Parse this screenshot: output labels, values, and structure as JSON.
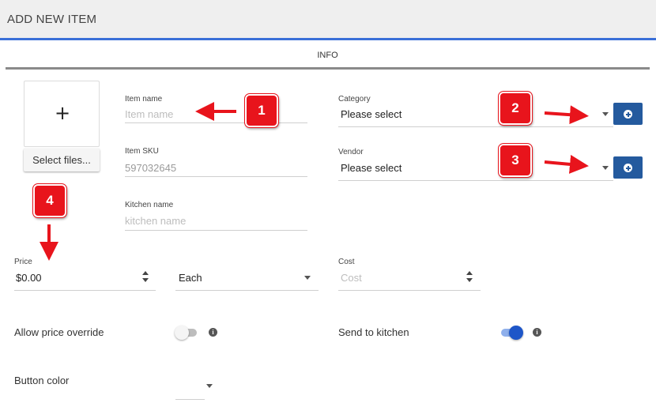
{
  "header": {
    "title": "ADD NEW ITEM"
  },
  "tabs": [
    {
      "label": "INFO"
    }
  ],
  "image": {
    "plus": "+",
    "select_files_label": "Select files..."
  },
  "item_name": {
    "label": "Item name",
    "placeholder": "Item name"
  },
  "item_sku": {
    "label": "Item SKU",
    "value": "597032645"
  },
  "kitchen_name": {
    "label": "Kitchen name",
    "placeholder": "kitchen name"
  },
  "category": {
    "label": "Category",
    "value": "Please select"
  },
  "vendor": {
    "label": "Vendor",
    "value": "Please select"
  },
  "price": {
    "label": "Price",
    "value": "$0.00"
  },
  "unit": {
    "value": "Each"
  },
  "cost": {
    "label": "Cost",
    "placeholder": "Cost"
  },
  "allow_price_override": {
    "label": "Allow price override",
    "enabled": false
  },
  "send_to_kitchen": {
    "label": "Send to kitchen",
    "enabled": true
  },
  "button_color": {
    "label": "Button color"
  },
  "annotations": [
    "1",
    "2",
    "3",
    "4"
  ],
  "colors": {
    "accent": "#3a6fd8",
    "add_button": "#245a9e",
    "toggle_on": "#1e56c8",
    "annotation_red": "#e8141c"
  },
  "icons": {
    "info": "info-icon",
    "add": "add-circle-icon",
    "dropdown": "caret-down-icon"
  }
}
